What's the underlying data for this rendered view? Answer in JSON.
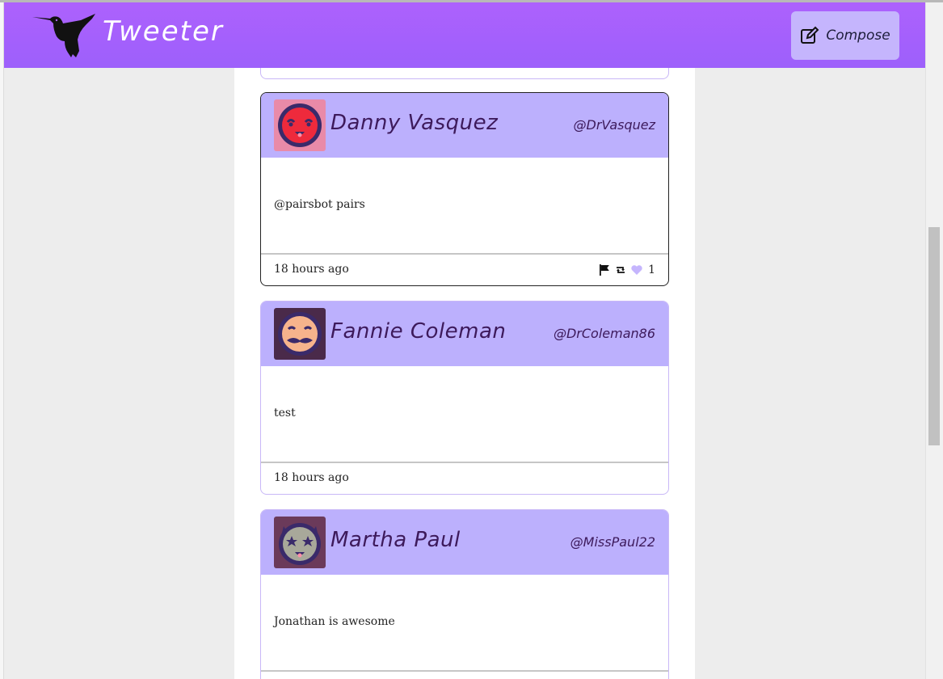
{
  "app": {
    "title": "Tweeter",
    "compose_label": "Compose"
  },
  "colors": {
    "nav_gradient_top": "#ad61fd",
    "nav_gradient_bottom": "#9d60fb",
    "card_header": "#bcb0fd",
    "compose_button": "#c5b5fd",
    "name_text": "#3d1a5b"
  },
  "tweets": [
    {
      "name": "Danny Vasquez",
      "handle": "@DrVasquez",
      "text": "@pairsbot pairs",
      "time": "18 hours ago",
      "likes": "1",
      "avatar_icon": "red-face-avatar-icon"
    },
    {
      "name": "Fannie Coleman",
      "handle": "@DrColeman86",
      "text": "test",
      "time": "18 hours ago",
      "avatar_icon": "mustache-face-avatar-icon"
    },
    {
      "name": "Martha Paul",
      "handle": "@MissPaul22",
      "text": "Jonathan is awesome",
      "avatar_icon": "star-eyes-face-avatar-icon"
    }
  ]
}
